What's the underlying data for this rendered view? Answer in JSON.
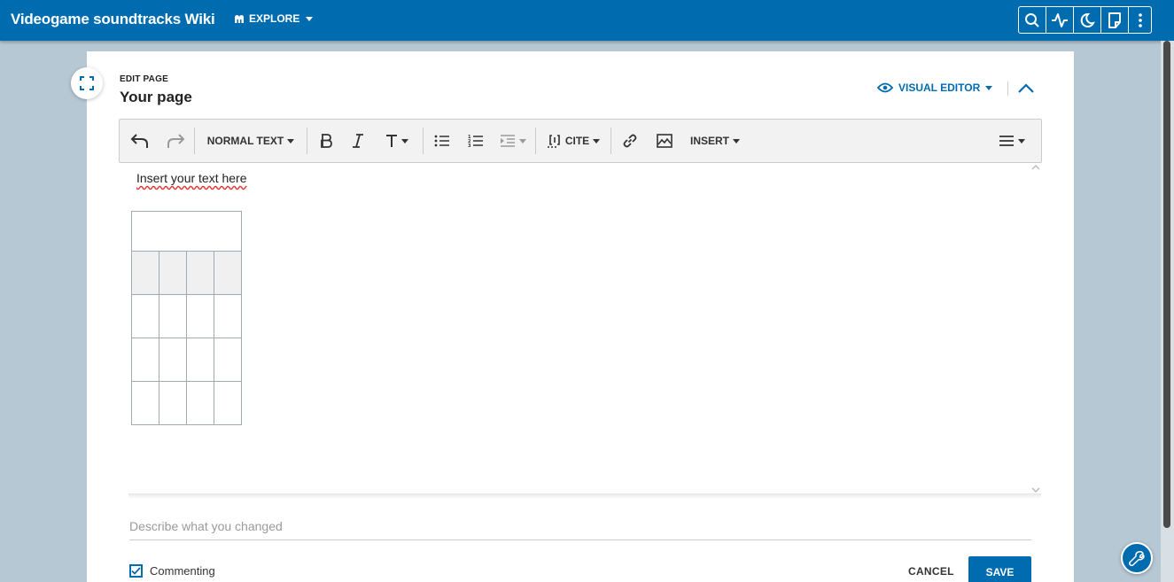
{
  "header": {
    "site_title": "Videogame soundtracks Wiki",
    "explore_label": "EXPLORE",
    "icons": [
      "search-icon",
      "activity-icon",
      "moon-icon",
      "page-icon",
      "more-icon"
    ]
  },
  "editor": {
    "section_label": "EDIT PAGE",
    "page_title": "Your page",
    "mode_label": "VISUAL EDITOR",
    "body_text": "Insert your text here",
    "table": {
      "header_rows": 1,
      "caption_row": true,
      "body_rows": 3,
      "columns": 4
    }
  },
  "toolbar": {
    "format_label": "NORMAL TEXT",
    "cite_label": "CITE",
    "insert_label": "INSERT"
  },
  "footer": {
    "summary_placeholder": "Describe what you changed",
    "commenting_label": "Commenting",
    "commenting_checked": true,
    "cancel_label": "CANCEL",
    "save_label": "SAVE"
  },
  "colors": {
    "brand": "#006cb0",
    "background": "#b7c8d5",
    "toolbar_bg": "#f2f2f2"
  }
}
